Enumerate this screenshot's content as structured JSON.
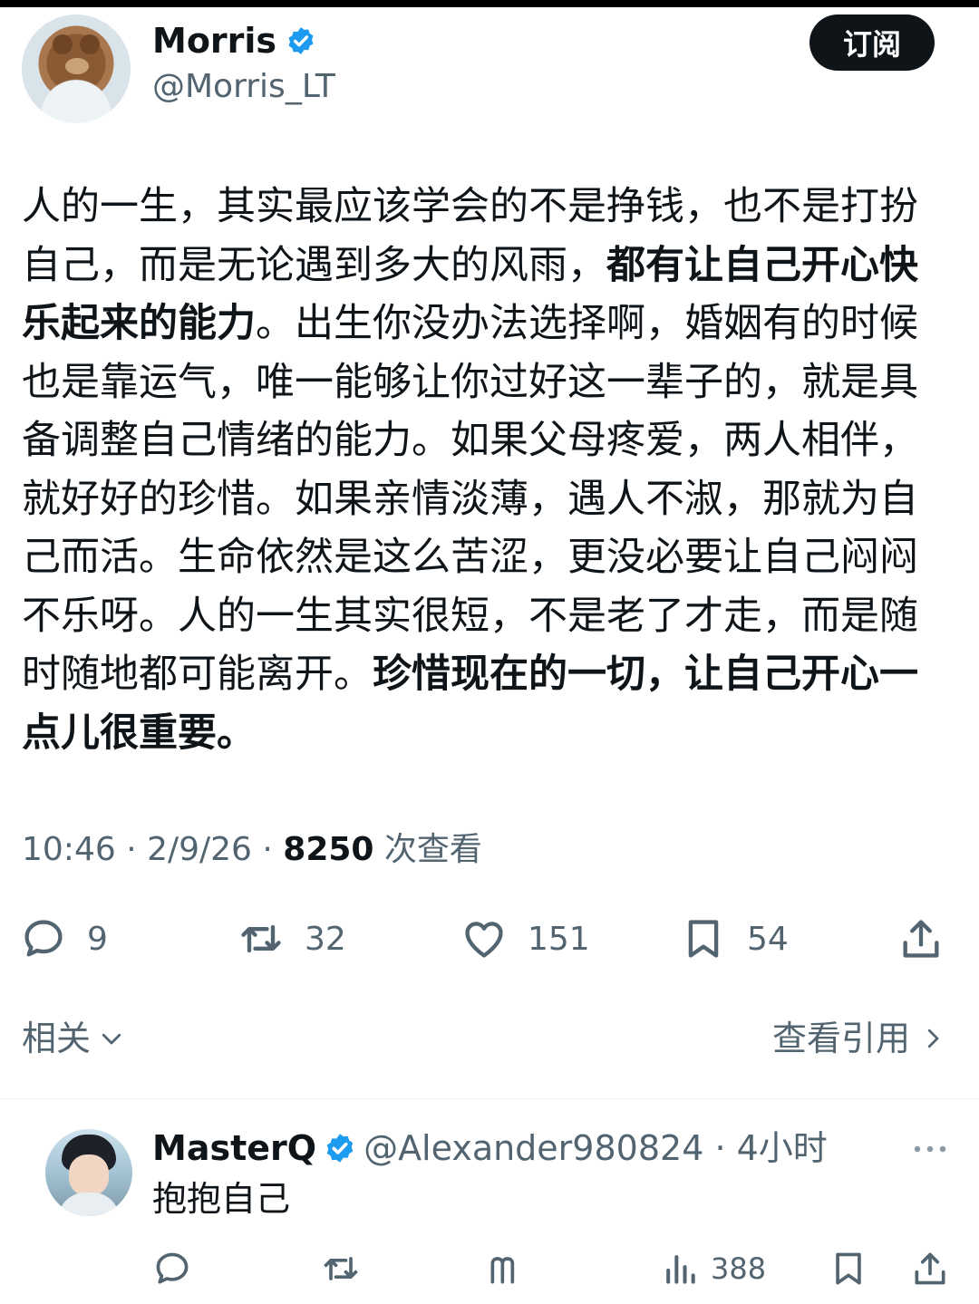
{
  "author": {
    "display_name": "Morris",
    "handle": "@Morris_LT",
    "verified_color": "#1d9bf0"
  },
  "subscribe_label": "订阅",
  "tweet": {
    "segments": [
      {
        "text": "人的一生，其实最应该学会的不是挣钱，也不是打扮自己，而是无论遇到多大的风雨，",
        "bold": false
      },
      {
        "text": "都有让自己开心快乐起来的能力",
        "bold": true
      },
      {
        "text": "。出生你没办法选择啊，婚姻有的时候也是靠运气，唯一能够让你过好这一辈子的，就是具备调整自己情绪的能力。如果父母疼爱，两人相伴，就好好的珍惜。如果亲情淡薄，遇人不淑，那就为自己而活。生命依然是这么苦涩，更没必要让自己闷闷不乐呀。人的一生其实很短，不是老了才走，而是随时随地都可能离开。",
        "bold": false
      },
      {
        "text": "珍惜现在的一切，让自己开心一点儿很重要。",
        "bold": true
      }
    ],
    "time": "10:46 · 2/9/26 · ",
    "views": "8250",
    "views_label": " 次查看"
  },
  "actions": {
    "replies": "9",
    "retweets": "32",
    "likes": "151",
    "bookmarks": "54"
  },
  "related_label": "相关",
  "quotes_label": "查看引用",
  "reply": {
    "display_name": "MasterQ",
    "handle_time": "@Alexander980824 · 4小时",
    "text": "抱抱自己",
    "views": "388"
  }
}
